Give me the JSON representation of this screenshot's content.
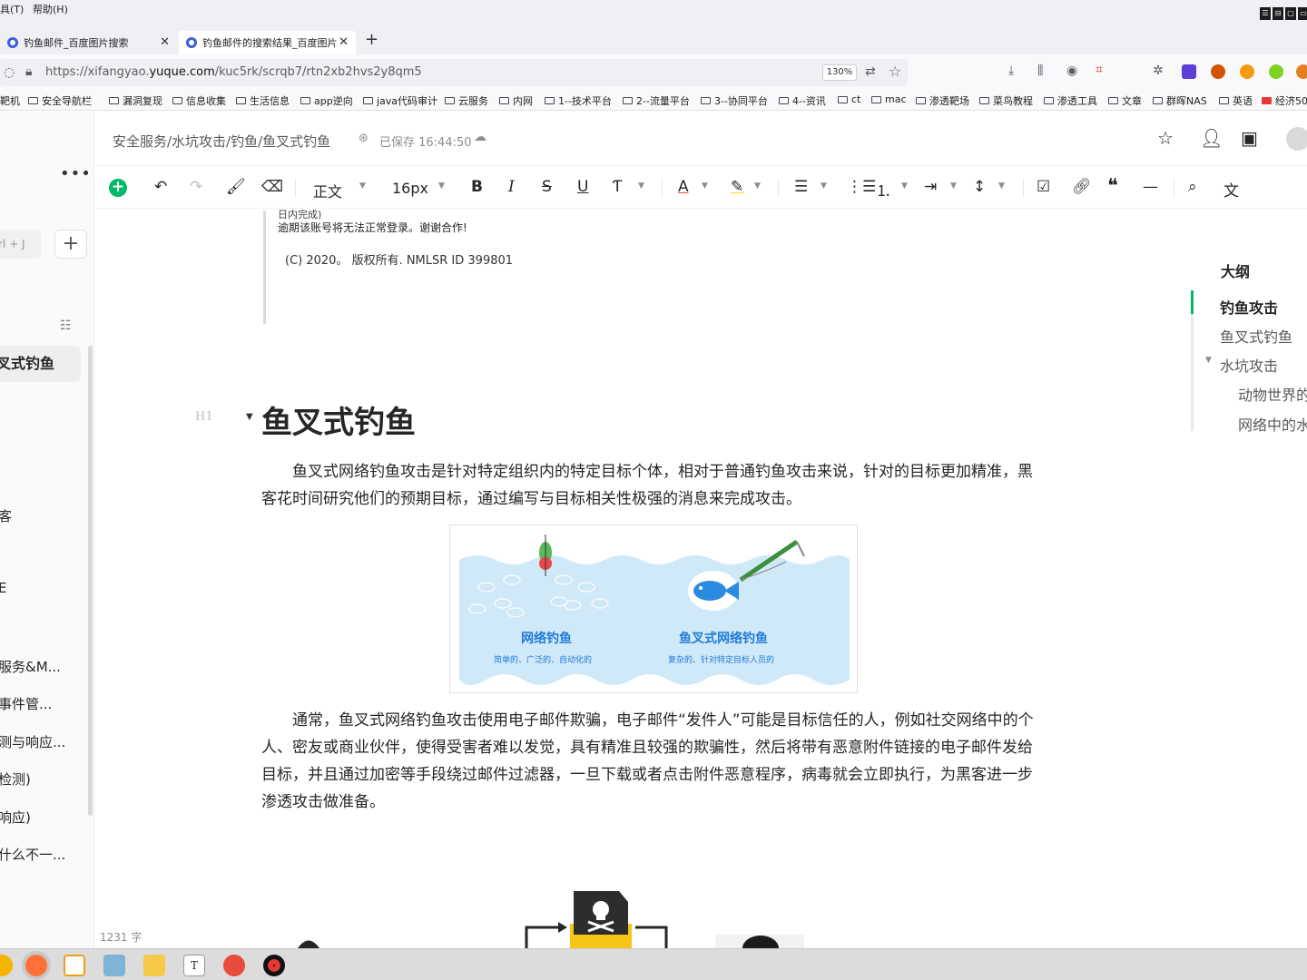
{
  "menubar": {
    "tools": "具(T)",
    "help": "帮助(H)"
  },
  "tabs": [
    {
      "title": "钓鱼邮件_百度图片搜索"
    },
    {
      "title": "钓鱼邮件的搜索结果_百度图片"
    }
  ],
  "address": {
    "prefix": "https://xifangyao.",
    "domain": "yuque.com",
    "path": "/kuc5rk/scrqb7/rtn2xb2hvs2y8qm5",
    "zoom": "130%"
  },
  "bookmarks": [
    "靶机",
    "安全导航栏",
    "漏洞复现",
    "信息收集",
    "生活信息",
    "app逆向",
    "java代码审计",
    "云服务",
    "内网",
    "1--技术平台",
    "2--流量平台",
    "3--协同平台",
    "4--资讯",
    "ct",
    "mac",
    "渗透靶场",
    "菜鸟教程",
    "渗透工具",
    "文章",
    "群晖NAS",
    "英语",
    "经济50"
  ],
  "sidebar": {
    "search_placeholder": "rl + J",
    "active_item": "叉式钓鱼",
    "items": [
      "客",
      "E",
      "服务&M...",
      "事件管...",
      "测与响应...",
      "检测)",
      "响应)",
      "什么不一..."
    ],
    "word_count": "1231 字"
  },
  "header": {
    "breadcrumb": "安全服务/水坑攻击/钓鱼/鱼叉式钓鱼",
    "save_status": "已保存 16:44:50"
  },
  "toolbar": {
    "style": "正文",
    "font_size": "16px"
  },
  "outline": {
    "title": "大纲",
    "items": [
      "钓鱼攻击",
      "鱼叉式钓鱼",
      "水坑攻击",
      "动物世界的",
      "网络中的水"
    ]
  },
  "quote": {
    "line1": "日内完成)",
    "line2": "逾期该账号将无法正常登录。谢谢合作!",
    "line3": "(C) 2020。 版权所有. NMLSR ID 399801"
  },
  "doc": {
    "h1": "鱼叉式钓鱼",
    "para1": "鱼叉式网络钓鱼攻击是针对特定组织内的特定目标个体，相对于普通钓鱼攻击来说，针对的目标更加精准，黑客花时间研究他们的预期目标，通过编写与目标相关性极强的消息来完成攻击。",
    "para2": "通常，鱼叉式网络钓鱼攻击使用电子邮件欺骗，电子邮件“发件人”可能是目标信任的人，例如社交网络中的个人、密友或商业伙伴，使得受害者难以发觉，具有精准且较强的欺骗性，然后将带有恶意附件链接的电子邮件发给目标，并且通过加密等手段绕过邮件过滤器，一旦下载或者点击附件恶意程序，病毒就会立即执行，为黑客进一步渗透攻击做准备。",
    "figure": {
      "left_title": "网络钓鱼",
      "left_sub": "简单的、广泛的、自动化的",
      "right_title": "鱼叉式网络钓鱼",
      "right_sub": "复杂的、针对特定目标人员的"
    }
  },
  "colors": {
    "brand": "#00b96b",
    "figure_water": "#cfe9f8",
    "figure_text": "#1f7ad6"
  }
}
